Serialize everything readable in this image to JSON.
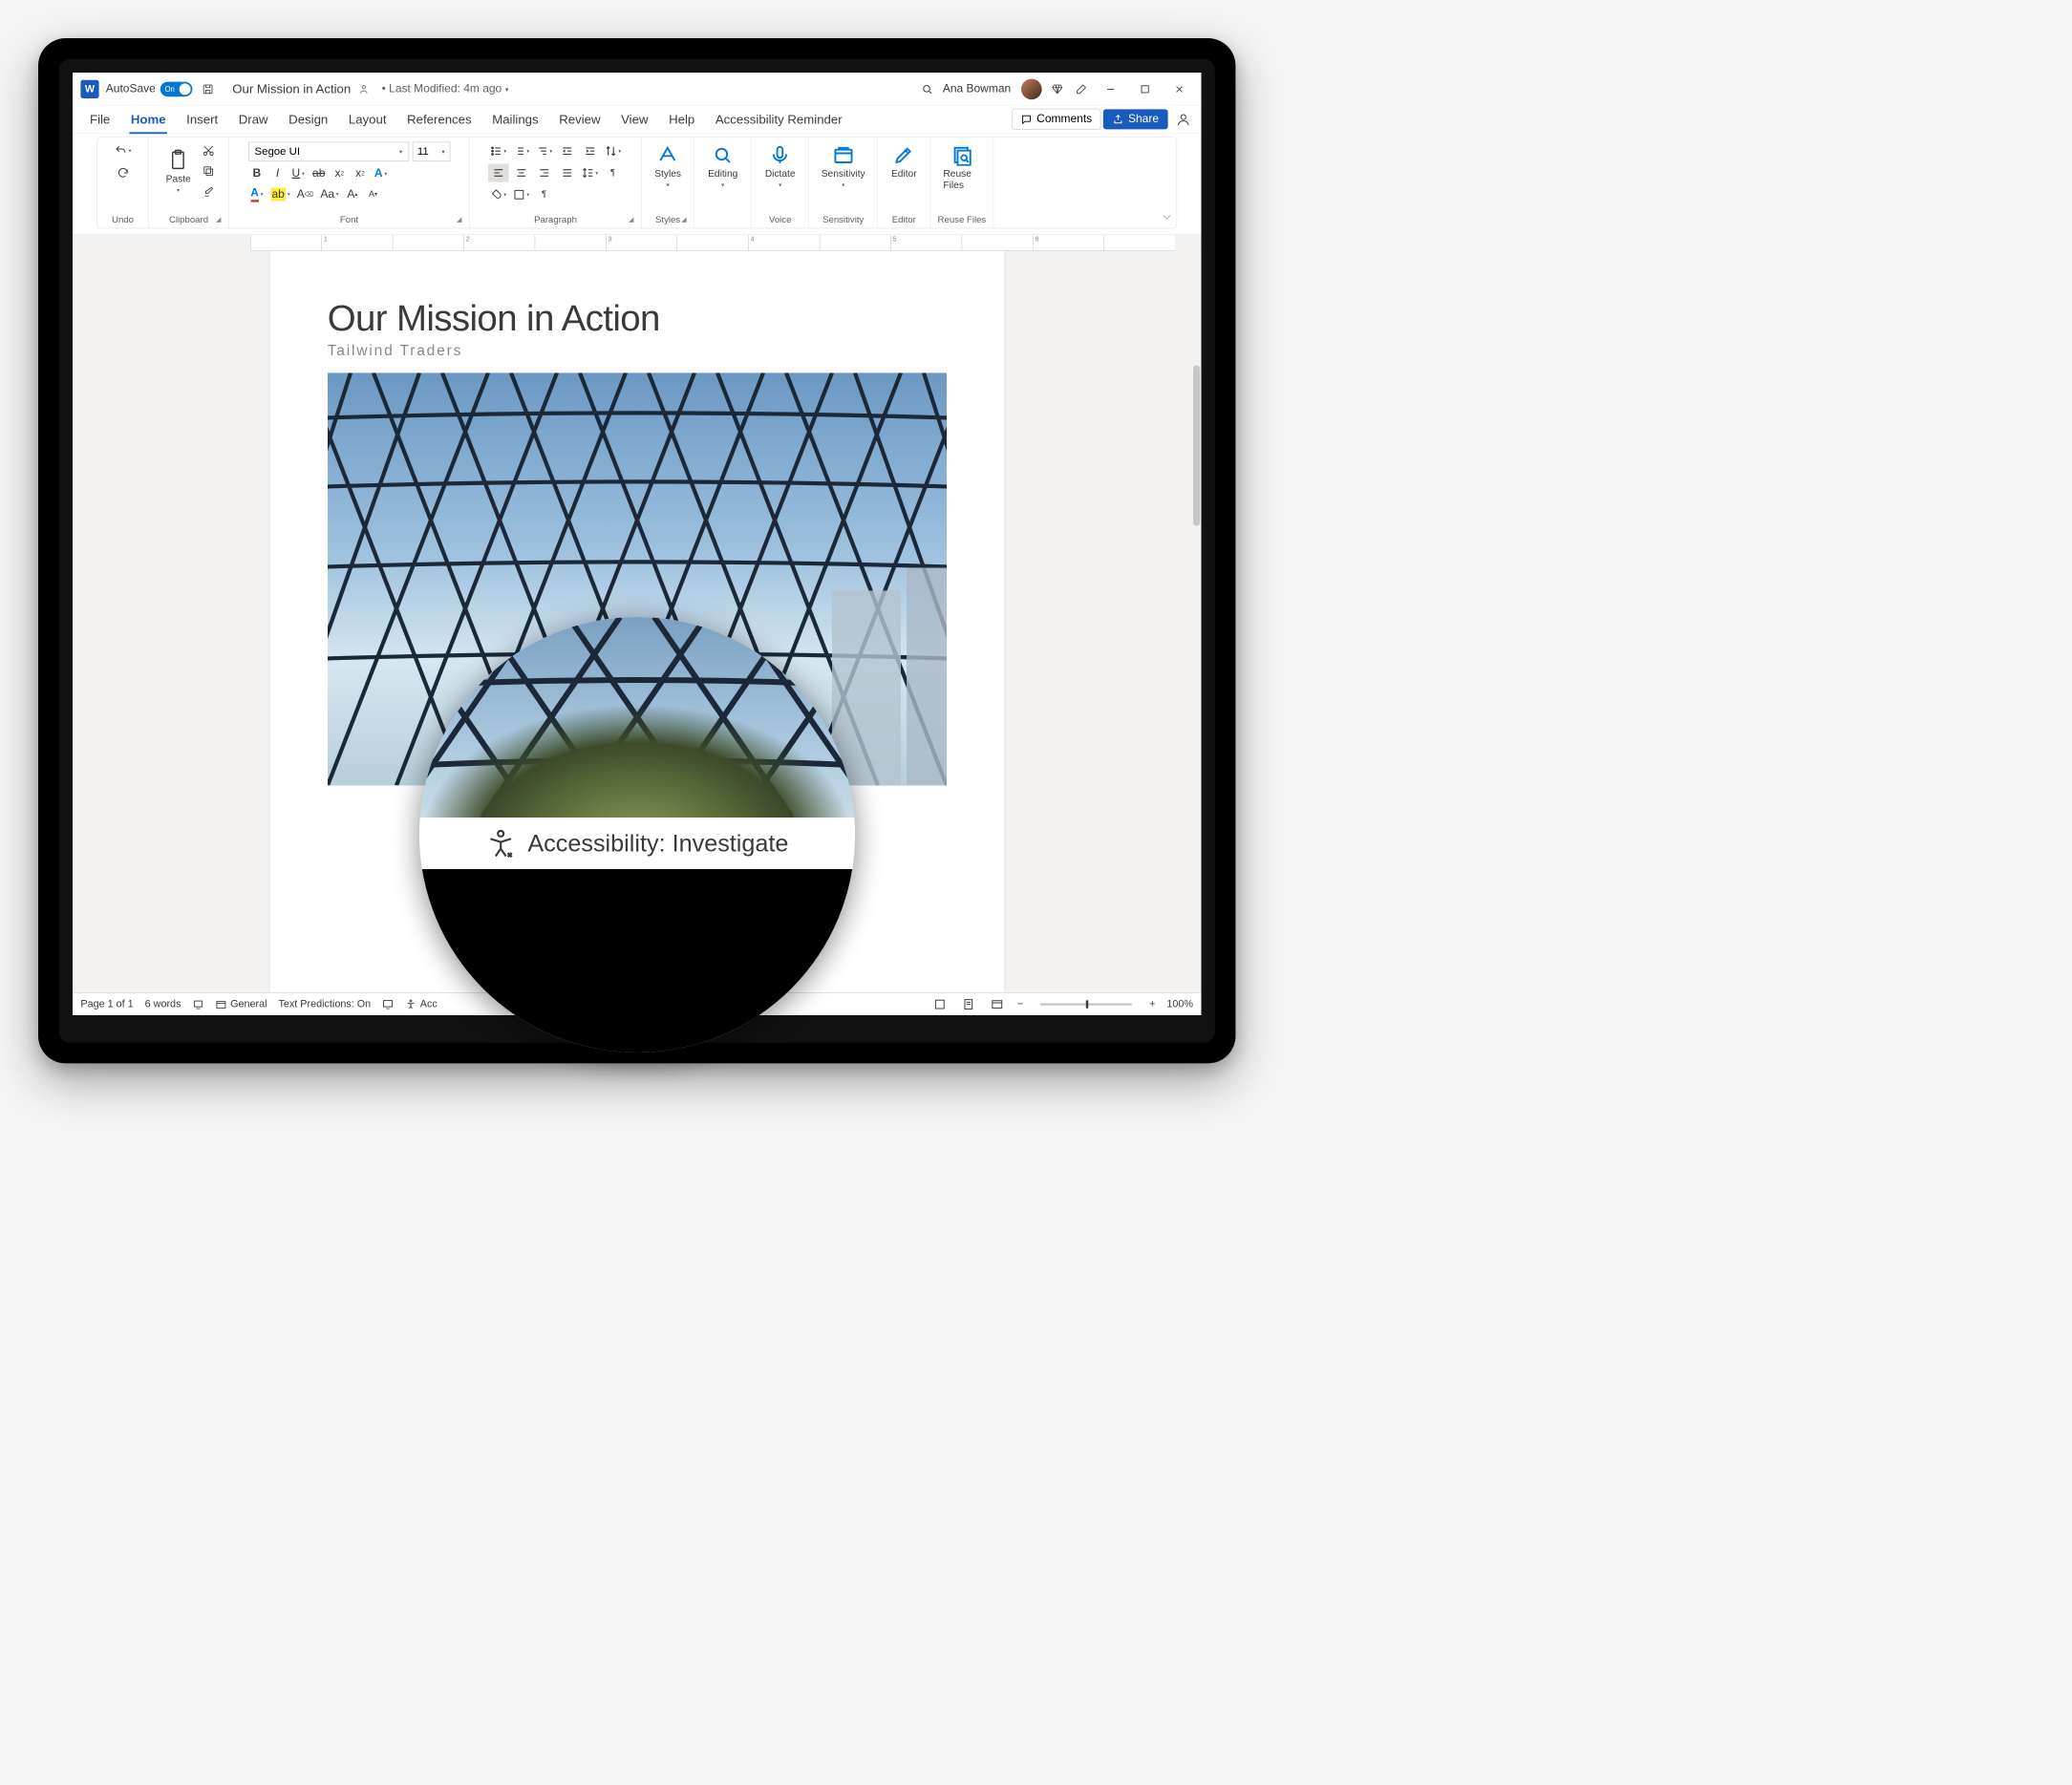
{
  "titlebar": {
    "app_icon_letter": "W",
    "autosave_label": "AutoSave",
    "autosave_state": "On",
    "doc_title": "Our Mission in Action",
    "last_modified": "• Last Modified: 4m ago",
    "user_name": "Ana Bowman"
  },
  "tabs": {
    "items": [
      "File",
      "Home",
      "Insert",
      "Draw",
      "Design",
      "Layout",
      "References",
      "Mailings",
      "Review",
      "View",
      "Help",
      "Accessibility Reminder"
    ],
    "active": "Home",
    "comments": "Comments",
    "share": "Share"
  },
  "ribbon": {
    "undo": "Undo",
    "clipboard": {
      "paste": "Paste",
      "label": "Clipboard"
    },
    "font": {
      "name": "Segoe UI",
      "size": "11",
      "label": "Font"
    },
    "paragraph": {
      "label": "Paragraph"
    },
    "styles": {
      "btn": "Styles",
      "label": "Styles"
    },
    "editing": "Editing",
    "dictate": {
      "btn": "Dictate",
      "label": "Voice"
    },
    "sensitivity": {
      "btn": "Sensitivity",
      "label": "Sensitivity"
    },
    "editor": {
      "btn": "Editor",
      "label": "Editor"
    },
    "reuse": {
      "btn": "Reuse Files",
      "label": "Reuse Files"
    }
  },
  "ruler_marks": [
    "",
    "1",
    "",
    "2",
    "",
    "3",
    "",
    "4",
    "",
    "5",
    "",
    "6",
    ""
  ],
  "document": {
    "heading": "Our Mission in Action",
    "subheading": "Tailwind Traders"
  },
  "statusbar": {
    "page": "Page 1 of 1",
    "words": "6 words",
    "focus": "General",
    "predictions": "Text Predictions: On",
    "accessibility_short": "Acc",
    "zoom": "100%"
  },
  "magnifier": {
    "label": "Accessibility: Investigate"
  }
}
